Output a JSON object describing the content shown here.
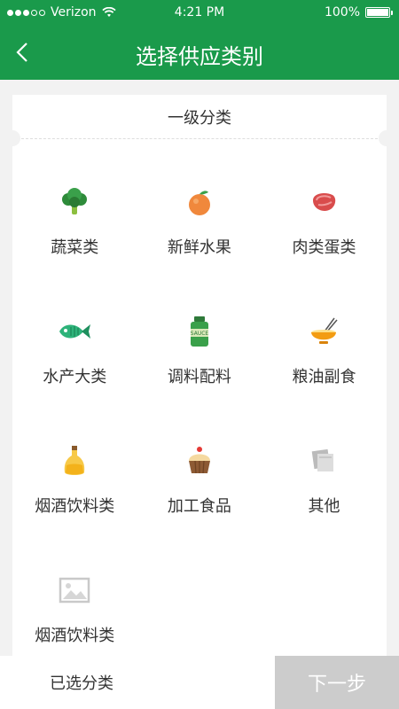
{
  "status_bar": {
    "carrier": "Verizon",
    "time": "4:21 PM",
    "battery": "100%"
  },
  "nav": {
    "title": "选择供应类别"
  },
  "section_header": "一级分类",
  "categories": [
    {
      "label": "蔬菜类",
      "icon": "broccoli-icon"
    },
    {
      "label": "新鲜水果",
      "icon": "orange-icon"
    },
    {
      "label": "肉类蛋类",
      "icon": "meat-icon"
    },
    {
      "label": "水产大类",
      "icon": "fish-icon"
    },
    {
      "label": "调料配料",
      "icon": "sauce-jar-icon"
    },
    {
      "label": "粮油副食",
      "icon": "noodle-bowl-icon"
    },
    {
      "label": "烟酒饮料类",
      "icon": "oil-bottle-icon"
    },
    {
      "label": "加工食品",
      "icon": "cupcake-icon"
    },
    {
      "label": "其他",
      "icon": "paper-stack-icon"
    },
    {
      "label": "烟酒饮料类",
      "icon": "image-placeholder-icon"
    }
  ],
  "bottom_bar": {
    "selected_label": "已选分类",
    "next_label": "下一步"
  },
  "colors": {
    "primary": "#1a9a4b",
    "next_disabled": "#cccccc"
  }
}
